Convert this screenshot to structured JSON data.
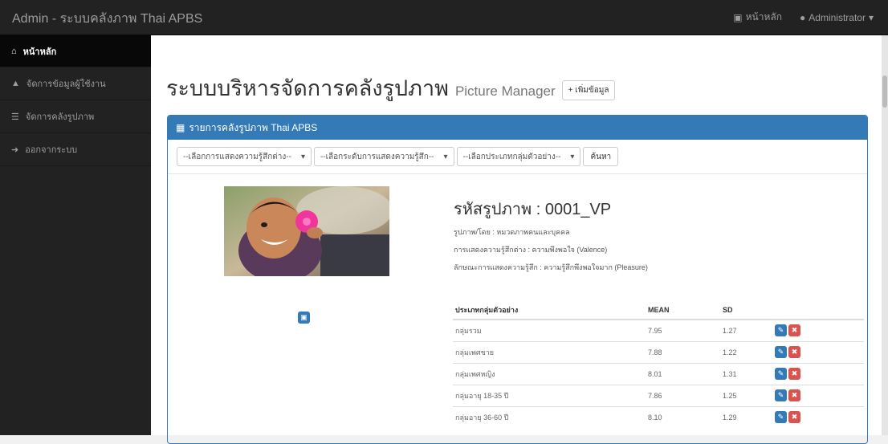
{
  "navbar": {
    "brand": "Admin - ระบบคลังภาพ Thai APBS",
    "home_link": "หน้าหลัก",
    "user_menu": "Administrator"
  },
  "sidebar": {
    "items": [
      {
        "label": "หน้าหลัก",
        "icon": "home-icon"
      },
      {
        "label": "จัดการข้อมูลผู้ใช้งาน",
        "icon": "user-icon"
      },
      {
        "label": "จัดการคลังรูปภาพ",
        "icon": "list-icon"
      },
      {
        "label": "ออกจากระบบ",
        "icon": "sign-out-icon"
      }
    ]
  },
  "page": {
    "title_th": "ระบบบริหารจัดการคลังรูปภาพ",
    "title_en": "Picture Manager",
    "add_button": "เพิ่มข้อมูล"
  },
  "panel": {
    "heading": "รายการคลังรูปภาพ Thai APBS",
    "filters": [
      "--เลือกการแสดงความรู้สึกต่าง--",
      "--เลือกระดับการแสดงความรู้สึก--",
      "--เลือกประเภทกลุ่มตัวอย่าง--"
    ],
    "search_button": "ค้นหา"
  },
  "picture": {
    "code": "รหัสรูปภาพ : 0001_VP",
    "category": "รูปภาพ/โดย : หมวดภาพคนและบุคคล",
    "dimension": "การแสดงความรู้สึกต่าง : ความพึงพอใจ (Valence)",
    "feeling": "ลักษณะการแสดงความรู้สึก : ความรู้สึกพึงพอใจมาก (Pleasure)"
  },
  "table": {
    "headers": [
      "ประเภทกลุ่มตัวอย่าง",
      "MEAN",
      "SD",
      ""
    ],
    "rows": [
      {
        "group": "กลุ่มรวม",
        "mean": "7.95",
        "sd": "1.27"
      },
      {
        "group": "กลุ่มเพศชาย",
        "mean": "7.88",
        "sd": "1.22"
      },
      {
        "group": "กลุ่มเพศหญิง",
        "mean": "8.01",
        "sd": "1.31"
      },
      {
        "group": "กลุ่มอายุ 18-35 ปี",
        "mean": "7.86",
        "sd": "1.25"
      },
      {
        "group": "กลุ่มอายุ 36-60 ปี",
        "mean": "8.10",
        "sd": "1.29"
      }
    ]
  },
  "colors": {
    "navbar_bg": "#222222",
    "panel_primary": "#337ab7",
    "delete_red": "#d9534f"
  }
}
